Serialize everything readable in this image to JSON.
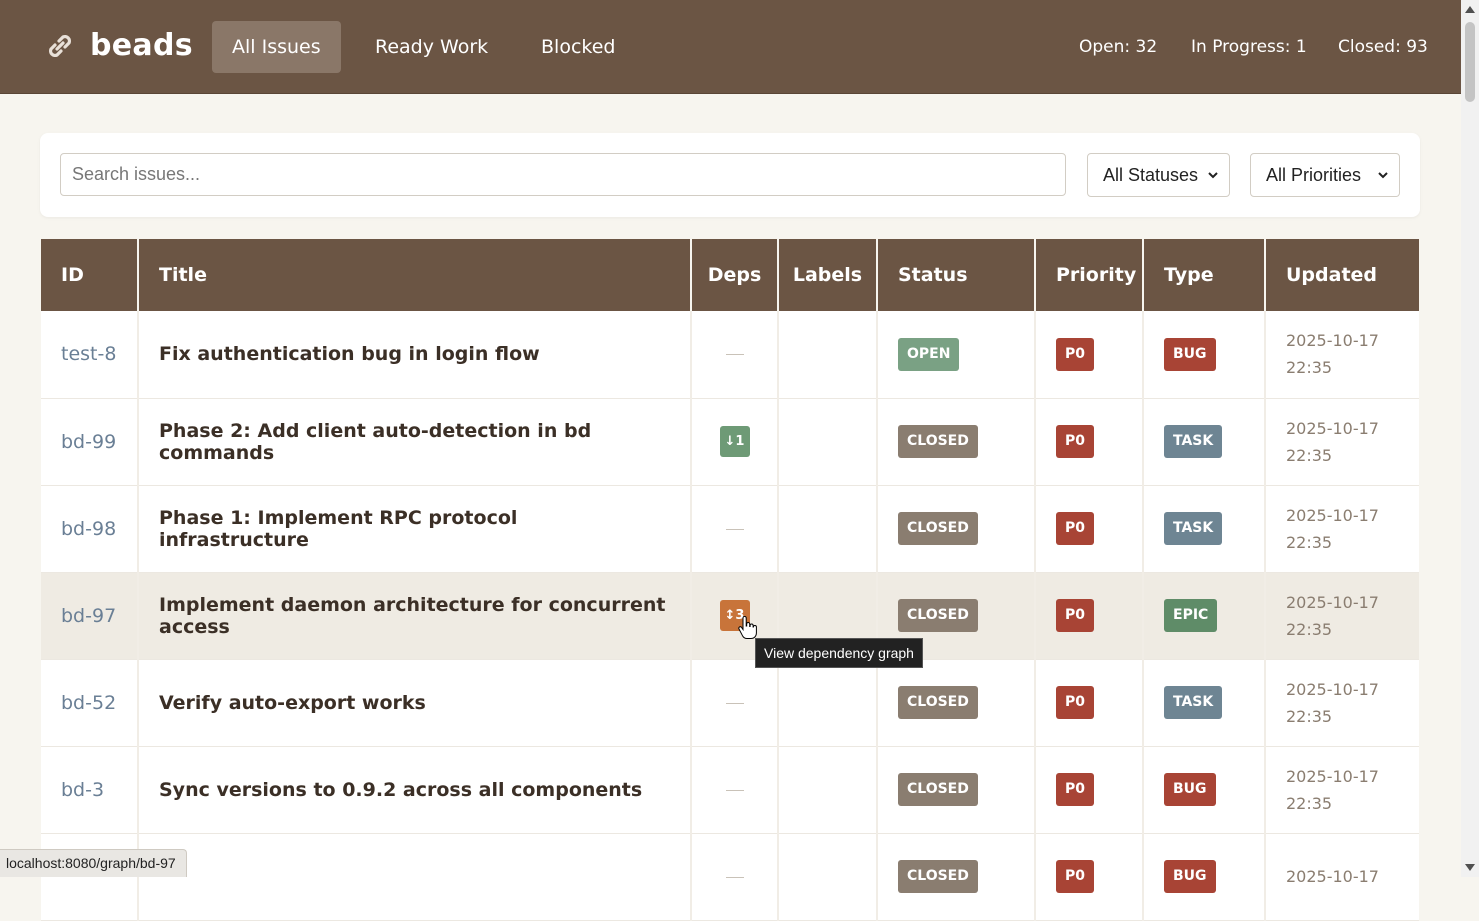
{
  "brand": {
    "name": "beads",
    "icon": "link-icon"
  },
  "nav": {
    "tabs": [
      "All Issues",
      "Ready Work",
      "Blocked"
    ],
    "active": "All Issues"
  },
  "stats": {
    "open": "Open: 32",
    "in_progress": "In Progress: 1",
    "closed": "Closed: 93"
  },
  "filters": {
    "search_placeholder": "Search issues...",
    "status_value": "All Statuses",
    "priority_value": "All Priorities"
  },
  "table": {
    "headers": [
      "ID",
      "Title",
      "Deps",
      "Labels",
      "Status",
      "Priority",
      "Type",
      "Updated"
    ],
    "rows": [
      {
        "id": "test-8",
        "title": "Fix authentication bug in login flow",
        "deps": "",
        "status": "OPEN",
        "priority": "P0",
        "type": "BUG",
        "updated_date": "2025-10-17",
        "updated_time": "22:35"
      },
      {
        "id": "bd-99",
        "title": "Phase 2: Add client auto-detection in bd commands",
        "deps": "↓1",
        "status": "CLOSED",
        "priority": "P0",
        "type": "TASK",
        "updated_date": "2025-10-17",
        "updated_time": "22:35"
      },
      {
        "id": "bd-98",
        "title": "Phase 1: Implement RPC protocol infrastructure",
        "deps": "",
        "status": "CLOSED",
        "priority": "P0",
        "type": "TASK",
        "updated_date": "2025-10-17",
        "updated_time": "22:35"
      },
      {
        "id": "bd-97",
        "title": "Implement daemon architecture for concurrent access",
        "deps": "↕3",
        "status": "CLOSED",
        "priority": "P0",
        "type": "EPIC",
        "updated_date": "2025-10-17",
        "updated_time": "22:35"
      },
      {
        "id": "bd-52",
        "title": "Verify auto-export works",
        "deps": "",
        "status": "CLOSED",
        "priority": "P0",
        "type": "TASK",
        "updated_date": "2025-10-17",
        "updated_time": "22:35"
      },
      {
        "id": "bd-3",
        "title": "Sync versions to 0.9.2 across all components",
        "deps": "",
        "status": "CLOSED",
        "priority": "P0",
        "type": "BUG",
        "updated_date": "2025-10-17",
        "updated_time": "22:35"
      },
      {
        "id": "",
        "title": "",
        "deps": "",
        "status": "CLOSED",
        "priority": "P0",
        "type": "BUG",
        "updated_date": "2025-10-17",
        "updated_time": ""
      }
    ]
  },
  "tooltip": "View dependency graph",
  "status_bar": "localhost:8080/graph/bd-97",
  "colors": {
    "header_bg": "#6b5544",
    "status_open": "#7aa184",
    "status_closed": "#8a7d70",
    "priority_p0": "#a84435",
    "type_bug": "#a84435",
    "type_task": "#6e8593",
    "type_epic": "#5f8c68",
    "dep_down": "#6e9a76",
    "dep_both": "#c8743a"
  }
}
